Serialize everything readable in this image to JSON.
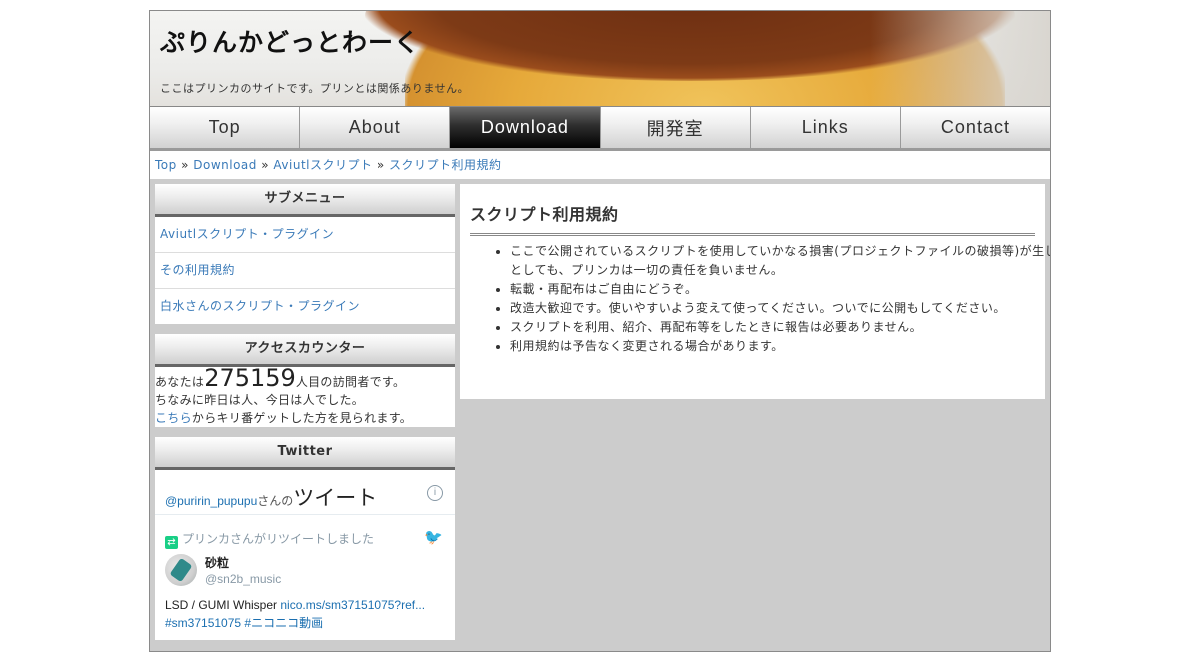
{
  "header": {
    "title": "ぷりんかどっとわーく",
    "description": "ここはプリンカのサイトです。プリンとは関係ありません。"
  },
  "nav": {
    "items": [
      {
        "label": "Top"
      },
      {
        "label": "About"
      },
      {
        "label": "Download",
        "active": true
      },
      {
        "label": "開発室"
      },
      {
        "label": "Links"
      },
      {
        "label": "Contact"
      }
    ]
  },
  "breadcrumb": {
    "items": [
      "Top",
      "Download",
      "Aviutlスクリプト",
      "スクリプト利用規約"
    ],
    "separator": "»"
  },
  "sidebar": {
    "submenu": {
      "title": "サブメニュー",
      "items": [
        "Aviutlスクリプト・プラグイン",
        "その利用規約",
        "白水さんのスクリプト・プラグイン"
      ]
    },
    "counter": {
      "title": "アクセスカウンター",
      "prefix": "あなたは",
      "count": "275159",
      "suffix": "人目の訪問者です。",
      "line2": "ちなみに昨日は人、今日は人でした。",
      "link": "こちら",
      "line3": "からキリ番ゲットした方を見られます。"
    },
    "twitter": {
      "title": "Twitter",
      "handle": "@puririn_pupupu",
      "san": "さんの",
      "tweet_word": "ツイート",
      "info": "i",
      "retweet_text": "プリンカさんがリツイートしました",
      "user_name": "砂粒",
      "user_id": "@sn2b_music",
      "text": "LSD / GUMI Whisper ",
      "link": "nico.ms/sm37151075?ref...",
      "hashtags": "#sm37151075 #ニコニコ動画"
    }
  },
  "main": {
    "title": "スクリプト利用規約",
    "rules": [
      "ここで公開されているスクリプトを使用していかなる損害(プロジェクトファイルの破損等)が生じたとしても、プリンカは一切の責任を負いません。",
      "転載・再配布はご自由にどうぞ。",
      "改造大歓迎です。使いやすいよう変えて使ってください。ついでに公開もしてください。",
      "スクリプトを利用、紹介、再配布等をしたときに報告は必要ありません。",
      "利用規約は予告なく変更される場合があります。"
    ]
  }
}
